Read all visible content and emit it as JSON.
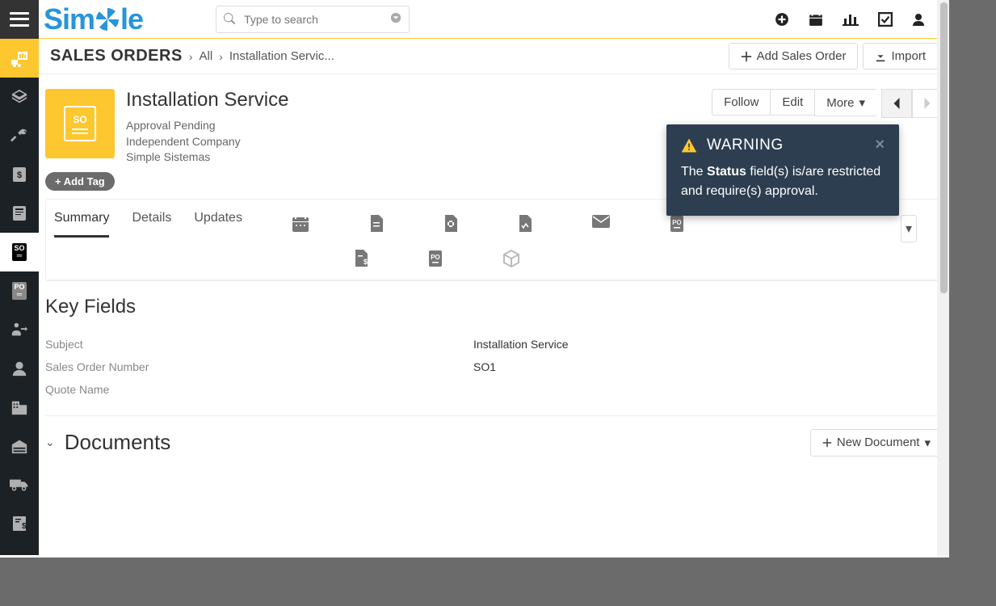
{
  "app": {
    "logo_text_before": "Sim",
    "logo_text_after": "le"
  },
  "search": {
    "placeholder": "Type to search"
  },
  "breadcrumb": {
    "module": "SALES ORDERS",
    "all": "All",
    "current": "Installation Servic..."
  },
  "actions": {
    "add": "Add Sales Order",
    "import": "Import"
  },
  "record": {
    "title": "Installation Service",
    "status": "Approval Pending",
    "company": "Independent Company",
    "org": "Simple Sistemas",
    "add_tag": "+ Add Tag",
    "follow": "Follow",
    "edit": "Edit",
    "more": "More"
  },
  "tabs": {
    "summary": "Summary",
    "details": "Details",
    "updates": "Updates"
  },
  "key_fields": {
    "title": "Key Fields",
    "rows": [
      {
        "label": "Subject",
        "value": "Installation Service"
      },
      {
        "label": "Sales Order Number",
        "value": "SO1"
      },
      {
        "label": "Quote Name",
        "value": ""
      }
    ]
  },
  "documents": {
    "title": "Documents",
    "new": "New Document"
  },
  "toast": {
    "title": "WARNING",
    "body_pre": "The ",
    "body_bold": "Status",
    "body_post": " field(s) is/are restricted and require(s) approval."
  }
}
